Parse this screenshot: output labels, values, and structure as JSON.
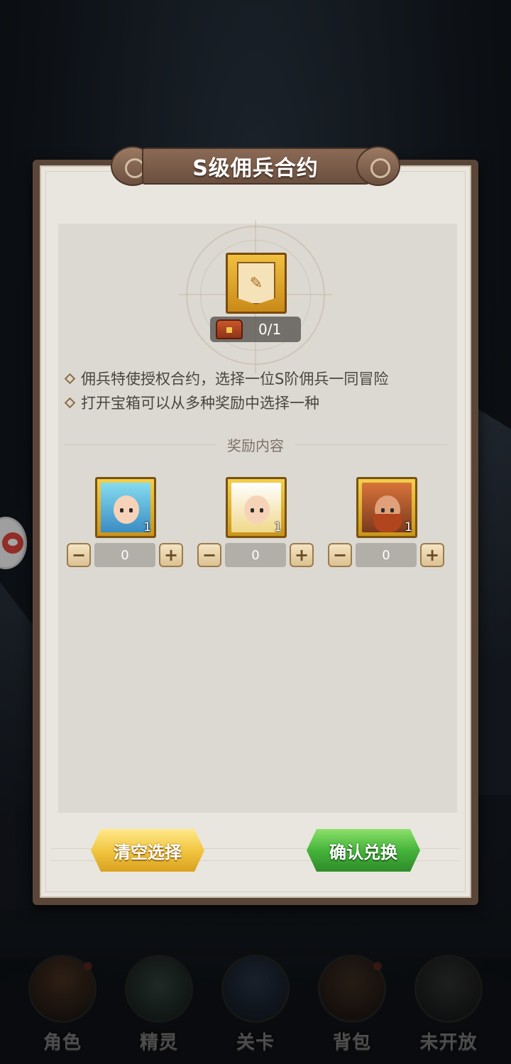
{
  "dialog": {
    "title": "S级佣兵合约",
    "count": "0/1",
    "descriptions": [
      "佣兵特使授权合约，选择一位S阶佣兵一同冒险",
      "打开宝箱可以从多种奖励中选择一种"
    ],
    "reward_header": "奖励内容",
    "rewards": [
      {
        "icon": "elf-hero-portrait",
        "quantity": "1",
        "selected": "0"
      },
      {
        "icon": "angel-hero-portrait",
        "quantity": "1",
        "selected": "0"
      },
      {
        "icon": "dwarf-warrior-portrait",
        "quantity": "1",
        "selected": "0"
      }
    ],
    "minus_label": "−",
    "plus_label": "+",
    "clear_button": "清空选择",
    "confirm_button": "确认兑换"
  },
  "bottom_nav": {
    "items": [
      {
        "label": "角色",
        "icon": "character-icon"
      },
      {
        "label": "精灵",
        "icon": "spirit-icon"
      },
      {
        "label": "关卡",
        "icon": "stage-icon"
      },
      {
        "label": "背包",
        "icon": "backpack-icon"
      },
      {
        "label": "未开放",
        "icon": "locked-icon"
      }
    ]
  },
  "colors": {
    "panel_frame": "#5a4638",
    "panel_bg": "#e9e6df",
    "clear_button": "#f2c642",
    "confirm_button": "#45b43a"
  }
}
